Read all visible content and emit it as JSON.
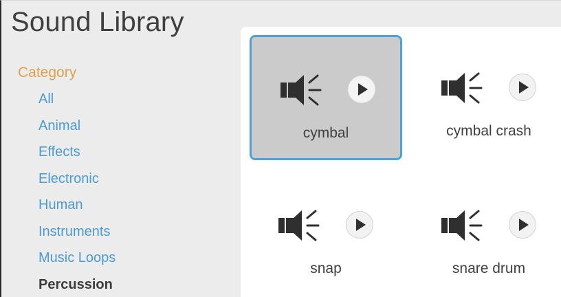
{
  "window": {
    "title": "Sound Library"
  },
  "sidebar": {
    "heading": "Category",
    "items": [
      {
        "label": "All",
        "selected": false
      },
      {
        "label": "Animal",
        "selected": false
      },
      {
        "label": "Effects",
        "selected": false
      },
      {
        "label": "Electronic",
        "selected": false
      },
      {
        "label": "Human",
        "selected": false
      },
      {
        "label": "Instruments",
        "selected": false
      },
      {
        "label": "Music Loops",
        "selected": false
      },
      {
        "label": "Percussion",
        "selected": true
      }
    ]
  },
  "sounds": [
    {
      "label": "cymbal",
      "selected": true,
      "icon": "speaker-icon",
      "action_icon": "play-icon"
    },
    {
      "label": "cymbal crash",
      "selected": false,
      "icon": "speaker-icon",
      "action_icon": "play-icon"
    },
    {
      "label": "snap",
      "selected": false,
      "icon": "speaker-icon",
      "action_icon": "play-icon"
    },
    {
      "label": "snare drum",
      "selected": false,
      "icon": "speaker-icon",
      "action_icon": "play-icon"
    }
  ],
  "colors": {
    "category_heading": "#e0a24a",
    "category_link": "#4b9bd3",
    "selected_border": "#4ea2da",
    "selected_tile_bg": "#cbcbcb",
    "icon_dark": "#2f2f2f"
  }
}
